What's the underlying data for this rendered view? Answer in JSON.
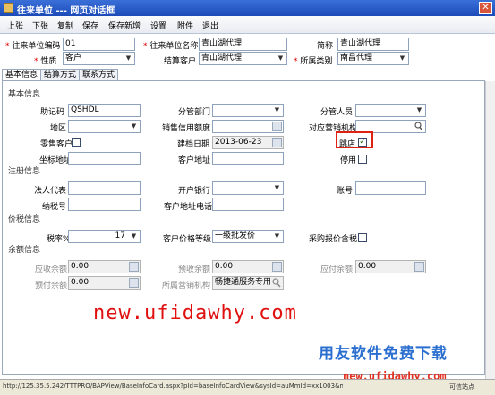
{
  "window": {
    "title": "往来单位  ---  网页对话框"
  },
  "menu": [
    "上张",
    "下张",
    "复制",
    "保存",
    "保存新增",
    "设置",
    "附件",
    "退出"
  ],
  "header": {
    "code_label": "往来单位编码",
    "code_value": "01",
    "name_label": "往来单位名称",
    "name_value": "青山湖代理",
    "short_label": "简称",
    "short_value": "青山湖代理",
    "nature_label": "性质",
    "nature_value": "客户",
    "settle_label": "结算客户",
    "settle_value": "青山湖代理",
    "category_label": "所属类别",
    "category_value": "南昌代理"
  },
  "tabs": [
    "基本信息",
    "结算方式",
    "联系方式"
  ],
  "sections": {
    "basic": "基本信息",
    "register": "注册信息",
    "price": "价税信息",
    "balance": "余额信息"
  },
  "basic": {
    "mnemonic_label": "助记码",
    "mnemonic_value": "QSHDL",
    "dept_label": "分管部门",
    "dept_value": "",
    "staff_label": "分管人员",
    "staff_value": "",
    "region_label": "地区",
    "region_value": "",
    "credit_label": "销售信用额度",
    "credit_value": "",
    "org_label": "对应营销机构",
    "org_value": "",
    "retail_label": "零售客户",
    "date_label": "建档日期",
    "date_value": "2013-06-23",
    "store_label": "跳店",
    "store_checked": true,
    "coords_label": "坐标地址",
    "coords_value": "",
    "addr_label": "客户地址",
    "addr_value": "",
    "disabled_label": "停用"
  },
  "register": {
    "legal_label": "法人代表",
    "legal_value": "",
    "bank_label": "开户银行",
    "bank_value": "",
    "account_label": "账号",
    "account_value": "",
    "tax_label": "纳税号",
    "tax_value": "",
    "phone_label": "客户地址电话",
    "phone_value": ""
  },
  "price": {
    "rate_label": "税率%",
    "rate_value": "17",
    "level_label": "客户价格等级",
    "level_value": "一级批发价",
    "purchase_label": "采购报价含税"
  },
  "balance": {
    "recv_label": "应收余额",
    "recv_value": "0.00",
    "prerecv_label": "预收余额",
    "prerecv_value": "0.00",
    "pay_label": "应付余额",
    "pay_value": "0.00",
    "prepay_label": "预付余额",
    "prepay_value": "0.00",
    "org_label": "所属营销机构",
    "org_value": "畅捷通服务专用"
  },
  "watermarks": {
    "url_red": "new.ufidawhy.com",
    "brand": "用友软件免费下载",
    "url_small": "new.ufidawhy.com"
  },
  "status": {
    "url": "http://125.35.5.242/TTTPRO/BAPView/BaseInfoCard.aspx?pId=baseInfoCardView&sysId=auMmId=xx1003&modeval",
    "zone": "可信站点"
  }
}
